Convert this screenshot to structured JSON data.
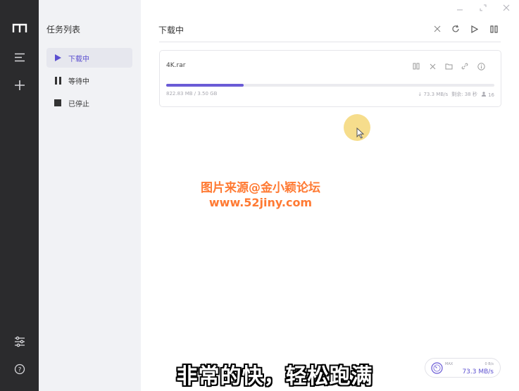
{
  "rail": {
    "items": [
      {
        "name": "logo",
        "icon": "motrix-logo-icon"
      },
      {
        "name": "menu",
        "icon": "menu-icon"
      },
      {
        "name": "add",
        "icon": "plus-icon"
      },
      {
        "name": "settings",
        "icon": "sliders-icon"
      },
      {
        "name": "help",
        "icon": "help-icon"
      }
    ]
  },
  "panel": {
    "title": "任务列表",
    "items": [
      {
        "label": "下载中",
        "icon": "play-icon",
        "active": true
      },
      {
        "label": "等待中",
        "icon": "pause-icon",
        "active": false
      },
      {
        "label": "已停止",
        "icon": "stop-icon",
        "active": false
      }
    ]
  },
  "main": {
    "title": "下载中",
    "toolbar": [
      "close-icon",
      "refresh-icon",
      "play-icon",
      "pause-icon"
    ],
    "window_controls": [
      "minimize-icon",
      "maximize-icon",
      "close-icon"
    ]
  },
  "task": {
    "name": "4K.rar",
    "progress": 0.235,
    "size": "822.83 MB / 3.50 GB",
    "speed": "↓ 73.3 MB/s",
    "remaining": "剩余: 38 秒",
    "connections": "16",
    "actions": [
      "pause-icon",
      "delete-icon",
      "folder-icon",
      "link-icon",
      "info-icon"
    ]
  },
  "watermark": {
    "line1": "图片来源@金小颖论坛",
    "line2": "www.52jiny.com"
  },
  "caption": "非常的快，轻松跑满",
  "speedometer": {
    "label": "MAX",
    "upload": "0 B/s",
    "download": "73.3 MB/s"
  },
  "colors": {
    "accent": "#6a5bd6",
    "rail_bg": "#2b2b2d",
    "panel_bg": "#f1f2f5",
    "watermark": "#ff7a33"
  }
}
